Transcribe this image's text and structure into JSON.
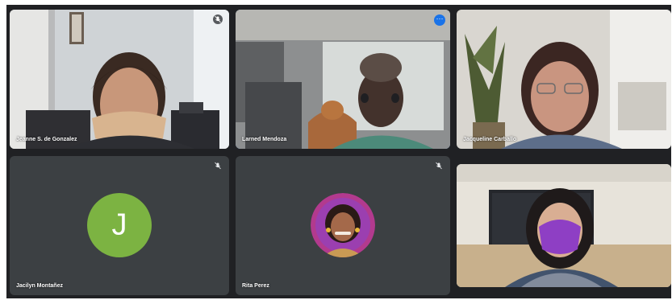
{
  "participants": [
    {
      "name": "Jeanne S. de Gonzalez",
      "muted": true,
      "video": true
    },
    {
      "name": "Larned Mendoza",
      "muted": false,
      "video": true,
      "active_speaker": true,
      "menu_icon": "more-options-icon"
    },
    {
      "name": "Jacqueline Carballo",
      "muted": false,
      "video": true
    },
    {
      "name": "Jacilyn Montañez",
      "muted": true,
      "video": false,
      "avatar_initial": "J",
      "avatar_color": "#7cb342"
    },
    {
      "name": "Rita Perez",
      "muted": true,
      "video": false,
      "avatar_type": "photo"
    },
    {
      "name": "",
      "muted": false,
      "video": true
    }
  ],
  "colors": {
    "stage_background": "#202124",
    "tile_background": "#3c4043",
    "active_border": "#8ab4f8",
    "menu_button": "#1a73e8"
  }
}
